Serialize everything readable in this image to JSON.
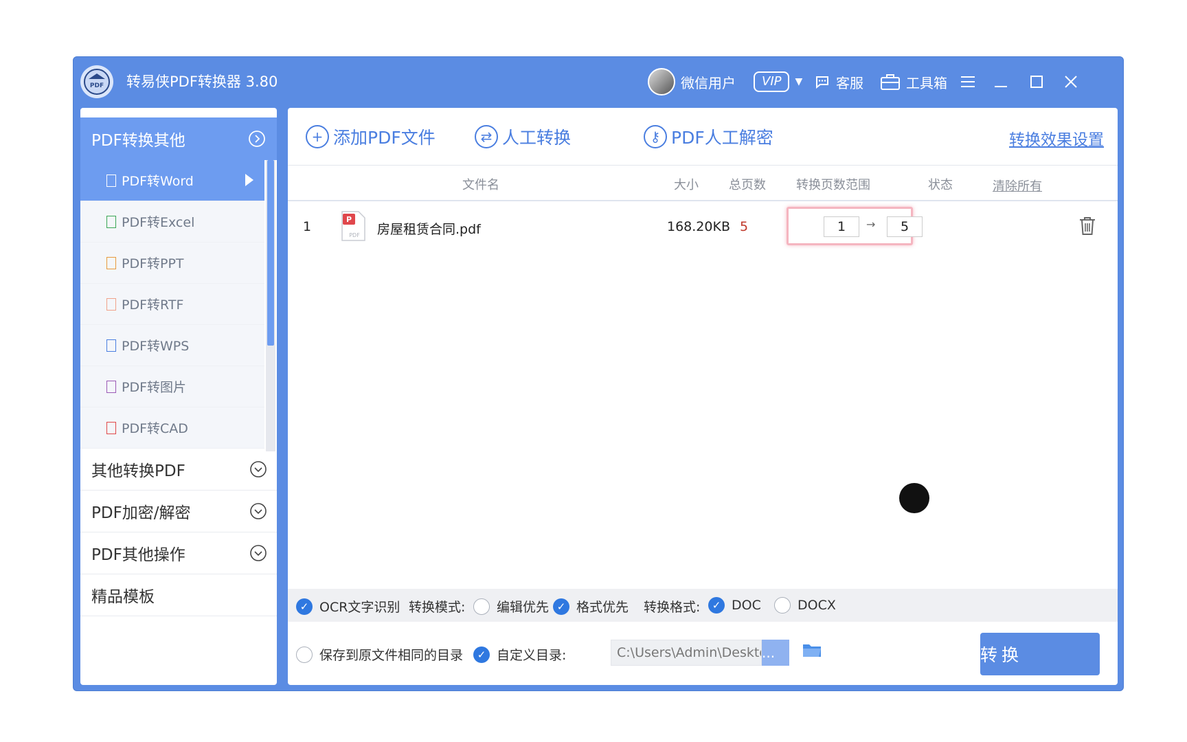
{
  "app": {
    "title": "转易侠PDF转换器 3.80",
    "user": "微信用户",
    "vip": "VIP",
    "service": "客服",
    "toolbox": "工具箱"
  },
  "sidebar": {
    "header": "PDF转换其他",
    "sub_items": [
      {
        "label": "PDF转Word",
        "icon": "word-doc-icon",
        "color": "#4a7ee0"
      },
      {
        "label": "PDF转Excel",
        "icon": "excel-doc-icon",
        "color": "#3aa655"
      },
      {
        "label": "PDF转PPT",
        "icon": "ppt-doc-icon",
        "color": "#e89a3c"
      },
      {
        "label": "PDF转RTF",
        "icon": "rtf-doc-icon",
        "color": "#f0a28a"
      },
      {
        "label": "PDF转WPS",
        "icon": "wps-doc-icon",
        "color": "#4a7ee0"
      },
      {
        "label": "PDF转图片",
        "icon": "image-doc-icon",
        "color": "#9b59b6"
      },
      {
        "label": "PDF转CAD",
        "icon": "cad-doc-icon",
        "color": "#e04848"
      }
    ],
    "sections": [
      "其他转换PDF",
      "PDF加密/解密",
      "PDF其他操作",
      "精品模板"
    ]
  },
  "toolbar": {
    "add_pdf": "添加PDF文件",
    "manual_convert": "人工转换",
    "manual_decrypt": "PDF人工解密",
    "settings": "转换效果设置"
  },
  "table": {
    "headers": {
      "filename": "文件名",
      "size": "大小",
      "pages": "总页数",
      "range": "转换页数范围",
      "status": "状态",
      "clear": "清除所有"
    },
    "rows": [
      {
        "index": "1",
        "name": "房屋租赁合同.pdf",
        "size": "168.20KB",
        "pages": "5",
        "from": "1",
        "to": "5",
        "icon_label": "PDF"
      }
    ]
  },
  "options": {
    "ocr": "OCR文字识别",
    "mode_label": "转换模式:",
    "mode_edit": "编辑优先",
    "mode_format": "格式优先",
    "format_label": "转换格式:",
    "fmt_doc": "DOC",
    "fmt_docx": "DOCX"
  },
  "save": {
    "same_dir": "保存到原文件相同的目录",
    "custom_dir": "自定义目录:",
    "path": "C:\\Users\\Admin\\Desktop\\",
    "browse": "...",
    "convert": "转换"
  }
}
